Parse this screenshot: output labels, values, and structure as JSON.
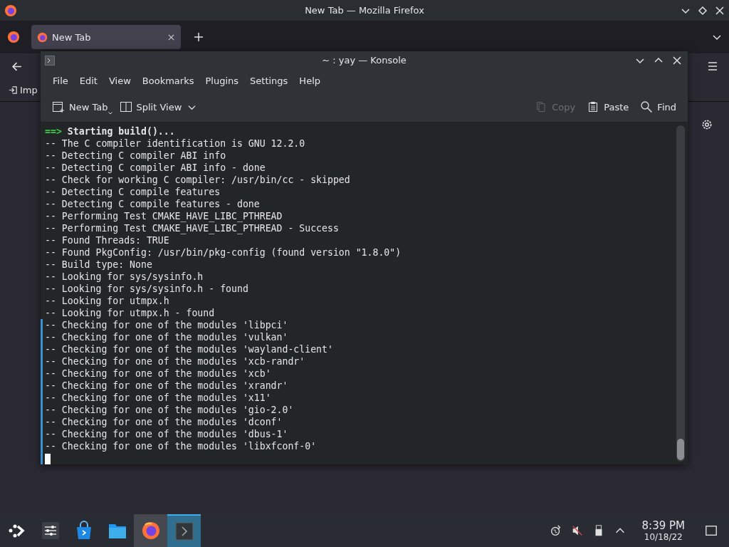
{
  "firefox": {
    "title": "New Tab — Mozilla Firefox",
    "tabs": [
      {
        "label": "New Tab",
        "selected": true
      }
    ],
    "bookmarks": [
      {
        "label": "Imp"
      }
    ]
  },
  "konsole": {
    "title": "~ : yay — Konsole",
    "menu": [
      "File",
      "Edit",
      "View",
      "Bookmarks",
      "Plugins",
      "Settings",
      "Help"
    ],
    "toolbar": [
      {
        "kind": "new-tab",
        "label": "New Tab",
        "disabled": false
      },
      {
        "kind": "split-view",
        "label": "Split View",
        "disabled": false
      },
      {
        "kind": "copy",
        "label": "Copy",
        "disabled": true
      },
      {
        "kind": "paste",
        "label": "Paste",
        "disabled": false
      },
      {
        "kind": "find",
        "label": "Find",
        "disabled": false
      }
    ],
    "lines": [
      {
        "kind": "header",
        "prompt": "==>",
        "text": "Starting build()...",
        "marked": false
      },
      {
        "kind": "plain",
        "text": "-- The C compiler identification is GNU 12.2.0",
        "marked": false
      },
      {
        "kind": "plain",
        "text": "-- Detecting C compiler ABI info",
        "marked": false
      },
      {
        "kind": "plain",
        "text": "-- Detecting C compiler ABI info - done",
        "marked": false
      },
      {
        "kind": "plain",
        "text": "-- Check for working C compiler: /usr/bin/cc - skipped",
        "marked": false
      },
      {
        "kind": "plain",
        "text": "-- Detecting C compile features",
        "marked": false
      },
      {
        "kind": "plain",
        "text": "-- Detecting C compile features - done",
        "marked": false
      },
      {
        "kind": "plain",
        "text": "-- Performing Test CMAKE_HAVE_LIBC_PTHREAD",
        "marked": false
      },
      {
        "kind": "plain",
        "text": "-- Performing Test CMAKE_HAVE_LIBC_PTHREAD - Success",
        "marked": false
      },
      {
        "kind": "plain",
        "text": "-- Found Threads: TRUE",
        "marked": false
      },
      {
        "kind": "plain",
        "text": "-- Found PkgConfig: /usr/bin/pkg-config (found version \"1.8.0\")",
        "marked": false
      },
      {
        "kind": "plain",
        "text": "-- Build type: None",
        "marked": false
      },
      {
        "kind": "plain",
        "text": "-- Looking for sys/sysinfo.h",
        "marked": false
      },
      {
        "kind": "plain",
        "text": "-- Looking for sys/sysinfo.h - found",
        "marked": false
      },
      {
        "kind": "plain",
        "text": "-- Looking for utmpx.h",
        "marked": false
      },
      {
        "kind": "plain",
        "text": "-- Looking for utmpx.h - found",
        "marked": false
      },
      {
        "kind": "plain",
        "text": "-- Checking for one of the modules 'libpci'",
        "marked": true
      },
      {
        "kind": "plain",
        "text": "-- Checking for one of the modules 'vulkan'",
        "marked": true
      },
      {
        "kind": "plain",
        "text": "-- Checking for one of the modules 'wayland-client'",
        "marked": true
      },
      {
        "kind": "plain",
        "text": "-- Checking for one of the modules 'xcb-randr'",
        "marked": true
      },
      {
        "kind": "plain",
        "text": "-- Checking for one of the modules 'xcb'",
        "marked": true
      },
      {
        "kind": "plain",
        "text": "-- Checking for one of the modules 'xrandr'",
        "marked": true
      },
      {
        "kind": "plain",
        "text": "-- Checking for one of the modules 'x11'",
        "marked": true
      },
      {
        "kind": "plain",
        "text": "-- Checking for one of the modules 'gio-2.0'",
        "marked": true
      },
      {
        "kind": "plain",
        "text": "-- Checking for one of the modules 'dconf'",
        "marked": true
      },
      {
        "kind": "plain",
        "text": "-- Checking for one of the modules 'dbus-1'",
        "marked": true
      },
      {
        "kind": "plain",
        "text": "-- Checking for one of the modules 'libxfconf-0'",
        "marked": true
      },
      {
        "kind": "cursor",
        "marked": true
      }
    ]
  },
  "taskbar": {
    "items": [
      {
        "kind": "launcher",
        "open": false,
        "selected": false
      },
      {
        "kind": "settings",
        "open": false,
        "selected": false
      },
      {
        "kind": "store",
        "open": false,
        "selected": false
      },
      {
        "kind": "files",
        "open": false,
        "selected": false
      },
      {
        "kind": "browser",
        "open": true,
        "selected": false
      },
      {
        "kind": "terminal",
        "open": true,
        "selected": true
      }
    ],
    "time": "8:39 PM",
    "date": "10/18/22"
  }
}
